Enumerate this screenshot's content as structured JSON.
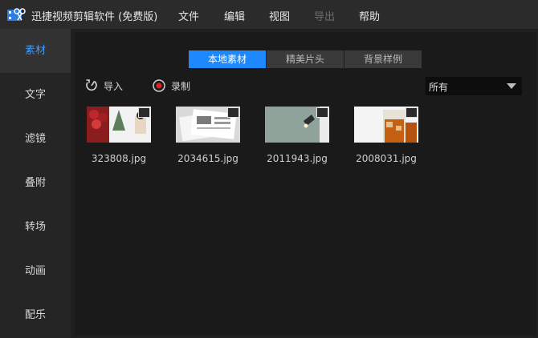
{
  "app": {
    "title": "迅捷视频剪辑软件 (免费版)"
  },
  "menu": [
    {
      "label": "文件",
      "disabled": false
    },
    {
      "label": "编辑",
      "disabled": false
    },
    {
      "label": "视图",
      "disabled": false
    },
    {
      "label": "导出",
      "disabled": true
    },
    {
      "label": "帮助",
      "disabled": false
    }
  ],
  "sidebar": {
    "items": [
      {
        "label": "素材",
        "active": true
      },
      {
        "label": "文字"
      },
      {
        "label": "滤镜"
      },
      {
        "label": "叠附"
      },
      {
        "label": "转场"
      },
      {
        "label": "动画"
      },
      {
        "label": "配乐"
      }
    ]
  },
  "tabs": [
    {
      "label": "本地素材",
      "active": true
    },
    {
      "label": "精美片头"
    },
    {
      "label": "背景样例"
    }
  ],
  "toolbar": {
    "import_label": "导入",
    "record_label": "录制"
  },
  "filter": {
    "selected": "所有"
  },
  "media": [
    {
      "name": "323808.jpg"
    },
    {
      "name": "2034615.jpg"
    },
    {
      "name": "2011943.jpg"
    },
    {
      "name": "2008031.jpg"
    }
  ],
  "colors": {
    "accent": "#1e88ff",
    "record": "#e02020"
  }
}
